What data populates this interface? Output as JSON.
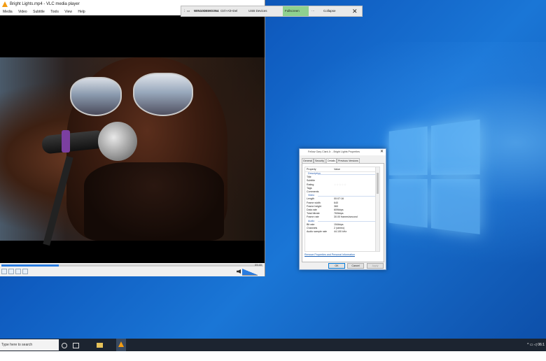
{
  "vlc": {
    "title": "Bright Lights.mp4 - VLC media player",
    "menu": [
      "Media",
      "Video",
      "Subtitle",
      "Tools",
      "View",
      "Help"
    ],
    "time_right": "09:40",
    "progress": 0.22,
    "volume_label": ""
  },
  "remote_bar": {
    "machine": "WIN10DEMO3N4",
    "ctrl_alt_del": "Ctrl+Alt+Del",
    "usb": "USB Devices",
    "fullscreen": "Fullscreen",
    "more": "···",
    "collapse": "Collapse",
    "close": "✕"
  },
  "props": {
    "title": "Fellow Gary Clark Jr. - Bright Lights Properties",
    "close": "✕",
    "tabs": [
      "General",
      "Security",
      "Details",
      "Previous Versions"
    ],
    "active_tab": "Details",
    "head": {
      "property": "Property",
      "value": "Value"
    },
    "rows": [
      {
        "type": "section",
        "p": "Description",
        "v": ""
      },
      {
        "type": "item",
        "p": "Title",
        "v": ""
      },
      {
        "type": "item",
        "p": "Subtitle",
        "v": ""
      },
      {
        "type": "item",
        "p": "Rating",
        "v": "☆☆☆☆☆"
      },
      {
        "type": "item",
        "p": "Tags",
        "v": ""
      },
      {
        "type": "item",
        "p": "Comments",
        "v": ""
      },
      {
        "type": "section",
        "p": "Video",
        "v": ""
      },
      {
        "type": "item",
        "p": "Length",
        "v": "00:07:16"
      },
      {
        "type": "item",
        "p": "Frame width",
        "v": "640"
      },
      {
        "type": "item",
        "p": "Frame height",
        "v": "360"
      },
      {
        "type": "item",
        "p": "Data rate",
        "v": "609kbps"
      },
      {
        "type": "item",
        "p": "Total bitrate",
        "v": "763kbps"
      },
      {
        "type": "item",
        "p": "Frame rate",
        "v": "30.00 frames/second"
      },
      {
        "type": "section",
        "p": "Audio",
        "v": ""
      },
      {
        "type": "item",
        "p": "Bit rate",
        "v": "154kbps"
      },
      {
        "type": "item",
        "p": "Channels",
        "v": "2 (stereo)"
      },
      {
        "type": "item",
        "p": "Audio sample rate",
        "v": "44.100 kHz"
      }
    ],
    "remove_link": "Remove Properties and Personal Information",
    "buttons": {
      "ok": "OK",
      "cancel": "Cancel",
      "apply": "Apply"
    }
  },
  "taskbar": {
    "search_placeholder": "Type here to search",
    "clock": "06:1"
  },
  "colors": {
    "accent": "#2b7de0",
    "fullscreen_green": "#8fd18f",
    "vlc_orange": "#f39c12"
  }
}
